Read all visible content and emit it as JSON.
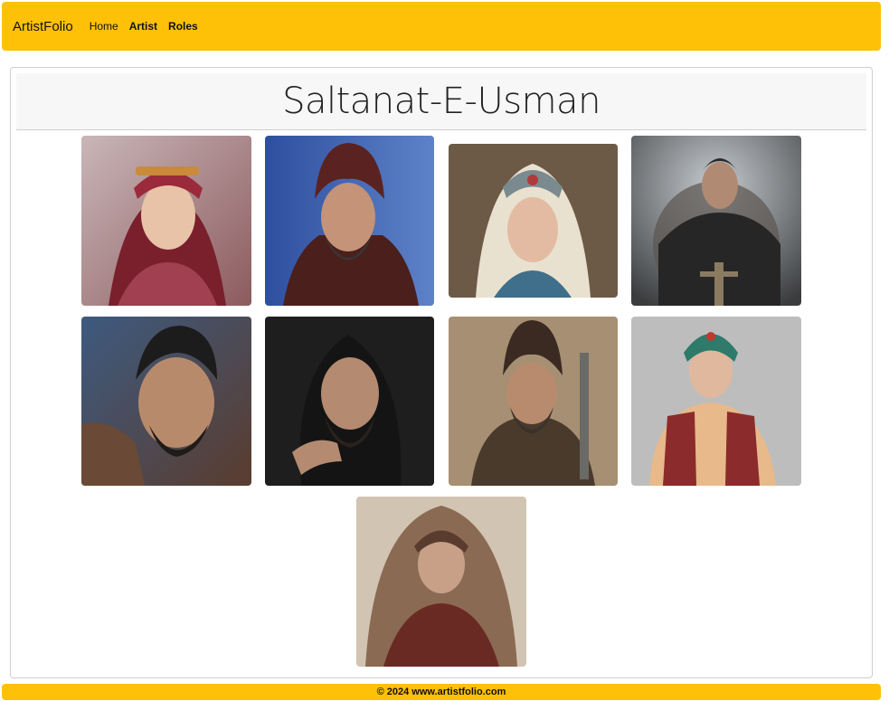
{
  "navbar": {
    "brand": "ArtistFolio",
    "links": [
      {
        "label": "Home"
      },
      {
        "label": "Artist"
      },
      {
        "label": "Roles"
      }
    ]
  },
  "page": {
    "title": "Saltanat-E-Usman"
  },
  "gallery": {
    "items": [
      {
        "icon": "portrait-woman-red-headdress"
      },
      {
        "icon": "portrait-man-dark-turban"
      },
      {
        "icon": "portrait-woman-white-headdress"
      },
      {
        "icon": "portrait-warrior-armor"
      },
      {
        "icon": "portrait-man-dark-hair"
      },
      {
        "icon": "portrait-man-long-hair"
      },
      {
        "icon": "portrait-man-turban-sword"
      },
      {
        "icon": "portrait-woman-embroidered-vest"
      },
      {
        "icon": "portrait-woman-veil"
      }
    ]
  },
  "footer": {
    "text": "© 2024 www.artistfolio.com"
  },
  "colors": {
    "accent": "#ffc107"
  }
}
